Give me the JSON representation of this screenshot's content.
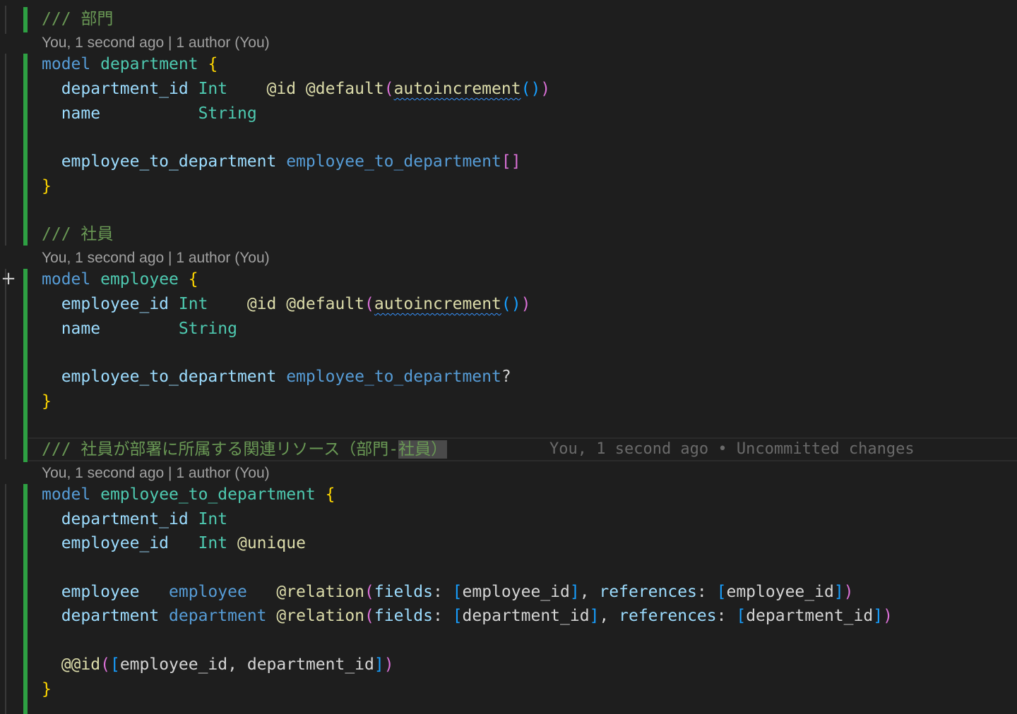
{
  "editor": {
    "colors": {
      "diff_bar": "#2ea043",
      "comment": "#6a9955",
      "keyword": "#569cd6",
      "type": "#4ec9b0",
      "field": "#9cdcfe",
      "attribute": "#dcdcaa",
      "bracket_1": "#ffd700",
      "bracket_2": "#da70d6",
      "bracket_3": "#179fff",
      "background": "#1e1e1e"
    },
    "gutter_icon": "add-line-icon",
    "codelens": "You, 1 second ago | 1 author (You)",
    "blame": "You, 1 second ago • Uncommitted changes",
    "tokens": {
      "comment_prefix": "///",
      "model_kw": "model",
      "open_brace": "{",
      "close_brace": "}",
      "int": "Int",
      "string": "String",
      "at_id": "@id",
      "at_default": "@default",
      "autoincrement": "autoincrement",
      "lparen": "(",
      "rparen": ")",
      "lbracket": "[",
      "rbracket": "]",
      "empty_list": "[]",
      "question": "?",
      "comma": ",",
      "at_unique": "@unique",
      "at_relation": "@relation",
      "fields_kw": "fields",
      "references_kw": "references",
      "colon": ":",
      "at_at_id": "@@id"
    },
    "comments": {
      "department": "部門",
      "employee": "社員",
      "relation_main": "社員が部署に所属する関連リソース（部門-",
      "relation_selected": "社員",
      "relation_end": "）"
    },
    "names": {
      "department": "department",
      "employee": "employee",
      "employee_to_department": "employee_to_department",
      "department_id": "department_id",
      "employee_id": "employee_id",
      "name": "name"
    }
  }
}
